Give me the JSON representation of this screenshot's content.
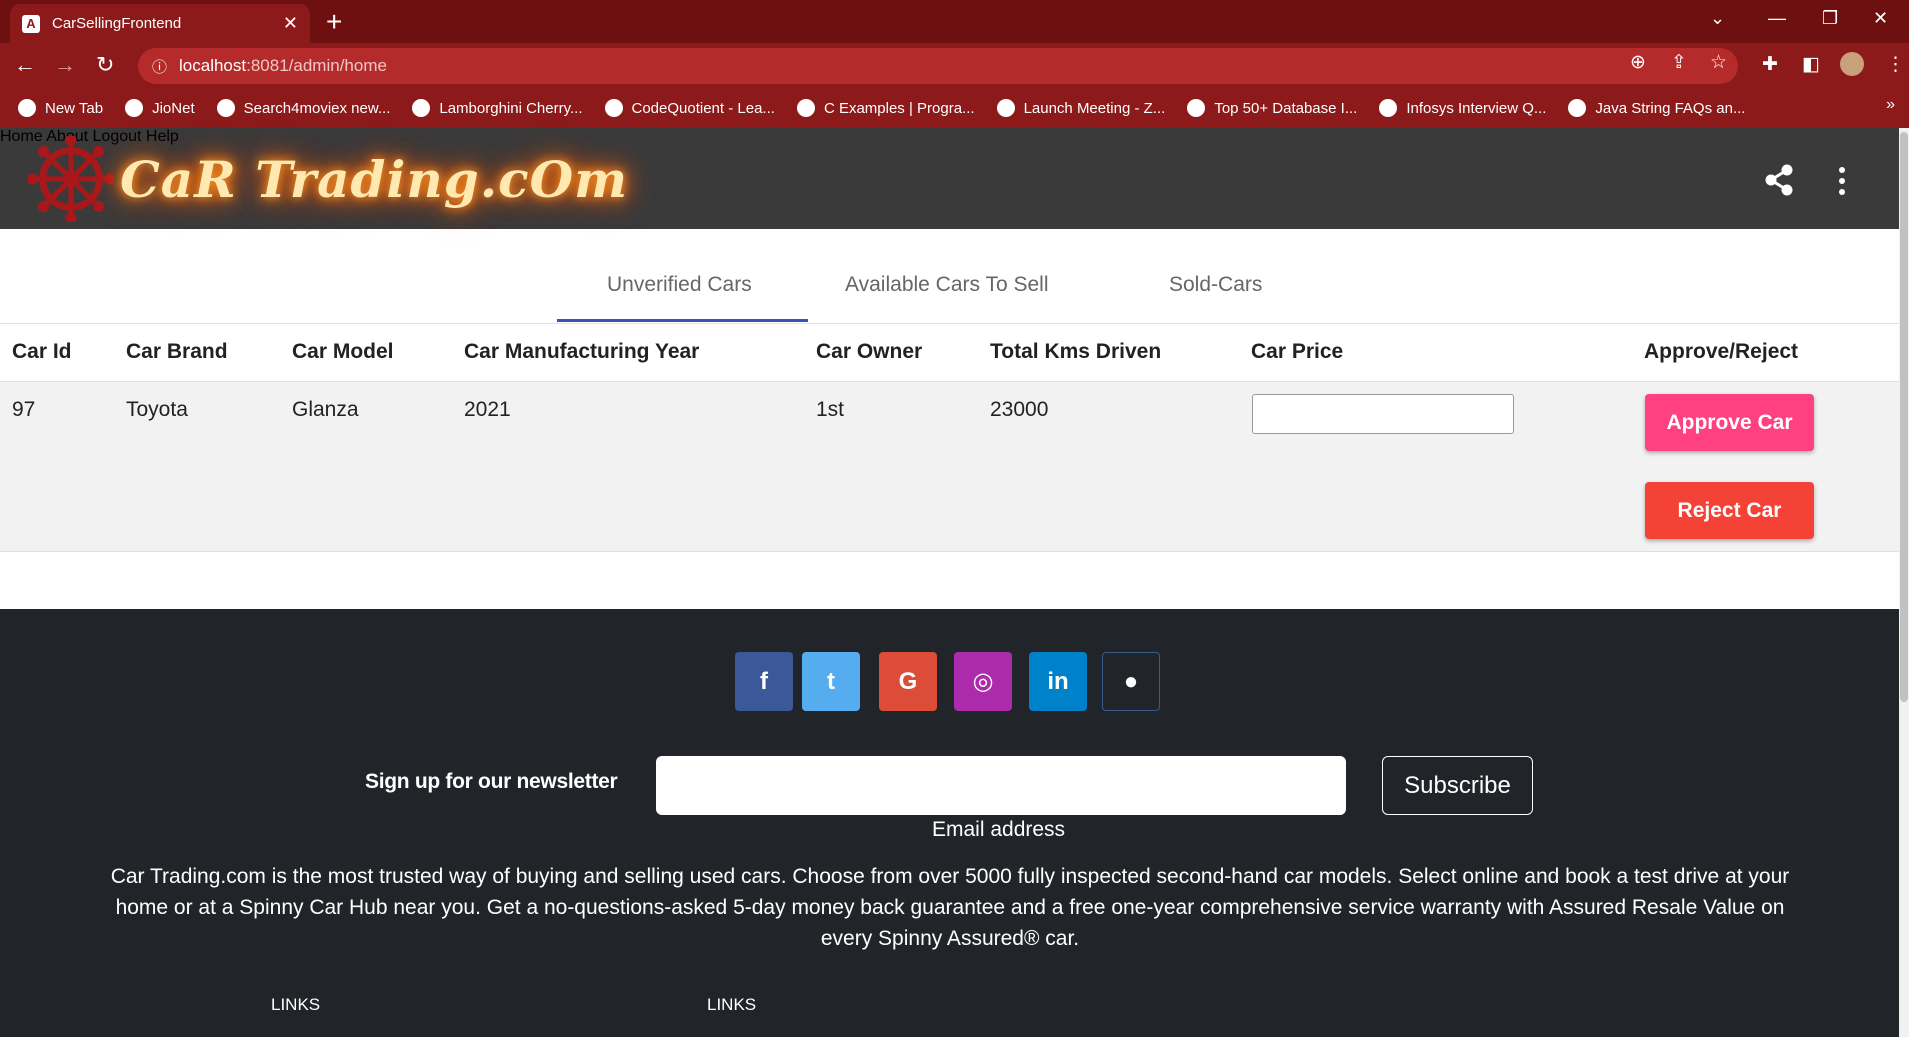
{
  "browser": {
    "tab_title": "CarSellingFrontend",
    "tab_favicon": "A",
    "url_host": "localhost",
    "url_path": ":8081/admin/home",
    "bookmarks": [
      {
        "label": "New Tab",
        "icon": "globe-icon"
      },
      {
        "label": "JioNet",
        "icon": "jio-icon"
      },
      {
        "label": "Search4moviex new...",
        "icon": "m-icon"
      },
      {
        "label": "Lamborghini Cherry...",
        "icon": "car-icon"
      },
      {
        "label": "CodeQuotient - Lea...",
        "icon": "cq-icon"
      },
      {
        "label": "C Examples | Progra...",
        "icon": "c-icon"
      },
      {
        "label": "Launch Meeting - Z...",
        "icon": "zoom-icon"
      },
      {
        "label": "Top 50+ Database I...",
        "icon": "db-icon"
      },
      {
        "label": "Infosys Interview Q...",
        "icon": "heart-icon"
      },
      {
        "label": "Java String FAQs an...",
        "icon": "heart-icon"
      }
    ],
    "bookmarks_more": "»"
  },
  "header": {
    "logo_text": "CaR Trading.cOm",
    "nav": [
      "Home",
      "About",
      "Logout",
      "Help"
    ]
  },
  "tabs": [
    "Unverified Cars",
    "Available Cars To Sell",
    "Sold-Cars"
  ],
  "table": {
    "columns": [
      "Car Id",
      "Car Brand",
      "Car Model",
      "Car Manufacturing Year",
      "Car Owner",
      "Total Kms Driven",
      "Car Price",
      "Approve/Reject"
    ],
    "rows": [
      {
        "id": "97",
        "brand": "Toyota",
        "model": "Glanza",
        "year": "2021",
        "owner": "1st",
        "kms": "23000",
        "price": ""
      }
    ],
    "approve_label": "Approve Car",
    "reject_label": "Reject Car"
  },
  "footer": {
    "social": [
      {
        "icon": "facebook-icon",
        "glyph": "f",
        "color": "#3b5998"
      },
      {
        "icon": "twitter-icon",
        "glyph": "t",
        "color": "#55acee"
      },
      {
        "icon": "google-icon",
        "glyph": "G",
        "color": "#dd4b39"
      },
      {
        "icon": "instagram-icon",
        "glyph": "◎",
        "color": "#ac2bac"
      },
      {
        "icon": "linkedin-icon",
        "glyph": "in",
        "color": "#0082ca"
      },
      {
        "icon": "github-icon",
        "glyph": "●",
        "color": "#333333"
      }
    ],
    "newsletter_label": "Sign up for our newsletter",
    "email_value": "",
    "email_hint": "Email address",
    "subscribe_label": "Subscribe",
    "about": "Car Trading.com is the most trusted way of buying and selling used cars. Choose from over 5000 fully inspected second-hand car models. Select online and book a test drive at your home or at a Spinny Car Hub near you. Get a no-questions-asked 5-day money back guarantee and a free one-year comprehensive service warranty with Assured Resale Value on every Spinny Assured® car.",
    "links_heading_1": "LINKS",
    "links_heading_2": "LINKS"
  }
}
